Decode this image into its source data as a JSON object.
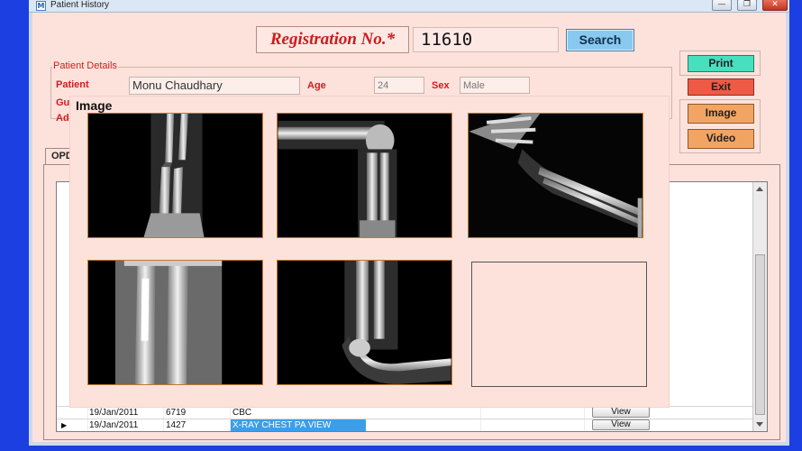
{
  "window": {
    "title": "Patient History",
    "icon": "app-logo-icon",
    "minimize_glyph": "—",
    "maximize_glyph": "❐",
    "close_glyph": "✕"
  },
  "registration": {
    "label": "Registration No.*",
    "value": "11610",
    "search_label": "Search"
  },
  "patient_details": {
    "legend": "Patient Details",
    "patient_label": "Patient",
    "patient_name": "Monu Chaudhary",
    "age_label": "Age",
    "age": "24",
    "sex_label": "Sex",
    "sex": "Male",
    "guardian_label": "Gua",
    "address_label": "Add"
  },
  "actions": {
    "print": "Print",
    "exit": "Exit",
    "image": "Image",
    "video": "Video"
  },
  "tabs": [
    {
      "label": "OPD"
    }
  ],
  "grid": {
    "rows": [
      {
        "marker": "",
        "date": "19/Jan/2011",
        "number": "6719",
        "test": "CBC",
        "button": "View",
        "selected": false
      },
      {
        "marker": "▶",
        "date": "19/Jan/2011",
        "number": "1427",
        "test": "X-RAY CHEST PA VIEW",
        "button": "View",
        "selected": true
      }
    ]
  },
  "image_dialog": {
    "title": "Image",
    "thumbnails": [
      {
        "name": "xray-forearm-fracture-1",
        "filled": true
      },
      {
        "name": "xray-elbow-lateral-1",
        "filled": true
      },
      {
        "name": "xray-hand-forearm",
        "filled": true
      },
      {
        "name": "xray-forearm-fracture-2",
        "filled": true
      },
      {
        "name": "xray-elbow-lateral-2",
        "filled": true
      },
      {
        "name": "empty-slot",
        "filled": false
      }
    ]
  },
  "colors": {
    "background": "#1b3fe0",
    "panel": "#fde2dc",
    "label_red": "#d11d1d",
    "search_button": "#89c9ef",
    "print_button": "#46e0bf",
    "exit_button": "#ef5a45",
    "media_button": "#f2a463",
    "selected_cell": "#3c9ee8"
  }
}
